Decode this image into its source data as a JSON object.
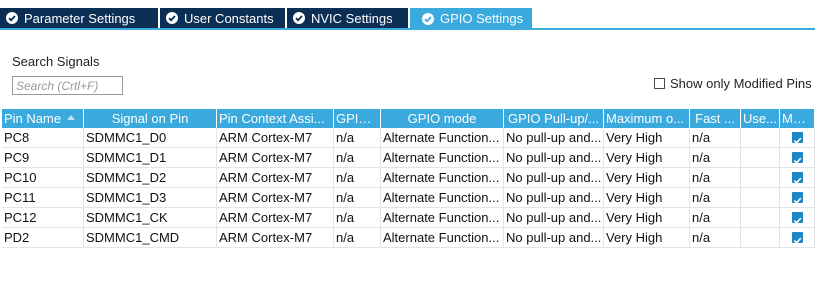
{
  "tabs": [
    {
      "label": "Parameter Settings",
      "active": false
    },
    {
      "label": "User Constants",
      "active": false
    },
    {
      "label": "NVIC Settings",
      "active": false
    },
    {
      "label": "GPIO Settings",
      "active": true
    }
  ],
  "search": {
    "label": "Search Signals",
    "placeholder": "Search (Crtl+F)"
  },
  "filter": {
    "show_modified_label": "Show only Modified Pins",
    "checked": false
  },
  "table": {
    "columns": [
      "Pin Name",
      "Signal on Pin",
      "Pin Context Assi...",
      "GPIO...",
      "GPIO mode",
      "GPIO Pull-up/...",
      "Maximum o...",
      "Fast ...",
      "Use...",
      "Mod..."
    ],
    "sorted_column": "Pin Name",
    "rows": [
      {
        "pin": "PC8",
        "signal": "SDMMC1_D0",
        "context": "ARM Cortex-M7",
        "gpio": "n/a",
        "mode": "Alternate Function...",
        "pull": "No pull-up and...",
        "speed": "Very High",
        "fast": "n/a",
        "user": "",
        "modified": true
      },
      {
        "pin": "PC9",
        "signal": "SDMMC1_D1",
        "context": "ARM Cortex-M7",
        "gpio": "n/a",
        "mode": "Alternate Function...",
        "pull": "No pull-up and...",
        "speed": "Very High",
        "fast": "n/a",
        "user": "",
        "modified": true
      },
      {
        "pin": "PC10",
        "signal": "SDMMC1_D2",
        "context": "ARM Cortex-M7",
        "gpio": "n/a",
        "mode": "Alternate Function...",
        "pull": "No pull-up and...",
        "speed": "Very High",
        "fast": "n/a",
        "user": "",
        "modified": true
      },
      {
        "pin": "PC11",
        "signal": "SDMMC1_D3",
        "context": "ARM Cortex-M7",
        "gpio": "n/a",
        "mode": "Alternate Function...",
        "pull": "No pull-up and...",
        "speed": "Very High",
        "fast": "n/a",
        "user": "",
        "modified": true
      },
      {
        "pin": "PC12",
        "signal": "SDMMC1_CK",
        "context": "ARM Cortex-M7",
        "gpio": "n/a",
        "mode": "Alternate Function...",
        "pull": "No pull-up and...",
        "speed": "Very High",
        "fast": "n/a",
        "user": "",
        "modified": true
      },
      {
        "pin": "PD2",
        "signal": "SDMMC1_CMD",
        "context": "ARM Cortex-M7",
        "gpio": "n/a",
        "mode": "Alternate Function...",
        "pull": "No pull-up and...",
        "speed": "Very High",
        "fast": "n/a",
        "user": "",
        "modified": true
      }
    ]
  },
  "colors": {
    "tab_inactive": "#0b2e55",
    "tab_active": "#3aa9dd",
    "header": "#3aa9dd",
    "checkbox": "#1e86c8"
  }
}
